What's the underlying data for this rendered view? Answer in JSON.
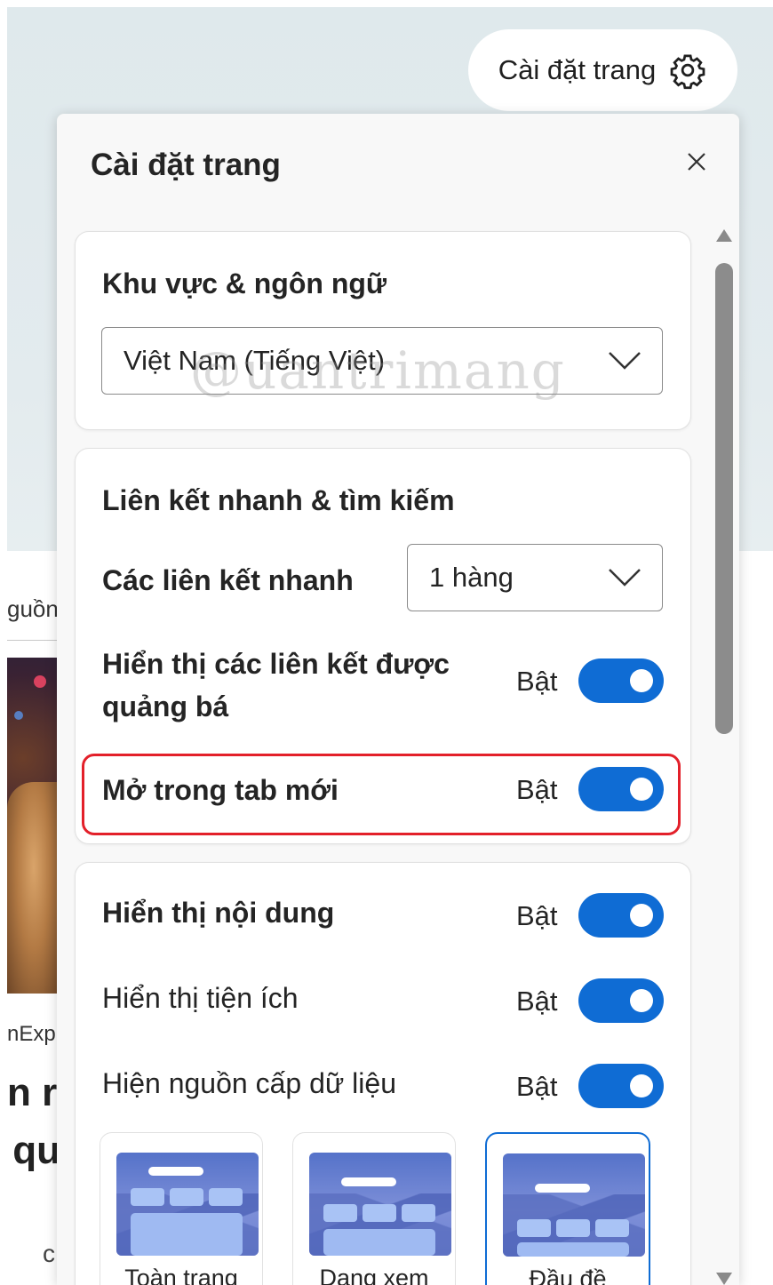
{
  "background": {
    "tab_fragment": "guồn",
    "source_fragment": "nExpr",
    "headline_line1": "n r",
    "headline_line2": "qu",
    "misc_fragment": "c"
  },
  "settings_button": {
    "label": "Cài đặt trang",
    "icon": "gear-icon"
  },
  "panel": {
    "title": "Cài đặt trang",
    "close_icon": "close-icon",
    "region": {
      "title": "Khu vực & ngôn ngữ",
      "selected": "Việt Nam (Tiếng Việt)"
    },
    "quicklinks": {
      "title": "Liên kết nhanh & tìm kiếm",
      "rows_label": "Các liên kết nhanh",
      "rows_value": "1 hàng",
      "promoted_label": "Hiển thị các liên kết được quảng bá",
      "promoted_state": "Bật",
      "newtab_label": "Mở trong tab mới",
      "newtab_state": "Bật"
    },
    "content": {
      "show_content_label": "Hiển thị nội dung",
      "show_content_state": "Bật",
      "widgets_label": "Hiển thị tiện ích",
      "widgets_state": "Bật",
      "feed_label": "Hiện nguồn cấp dữ liệu",
      "feed_state": "Bật"
    },
    "layouts": [
      {
        "label": "Toàn trang",
        "selected": false
      },
      {
        "label": "Dạng xem",
        "selected": false
      },
      {
        "label": "Đầu đề",
        "selected": true
      }
    ]
  },
  "watermark": "@uantrimang",
  "colors": {
    "accent": "#0f6cd4",
    "highlight": "#e3202a",
    "panel_bg": "#f8f8f8"
  }
}
